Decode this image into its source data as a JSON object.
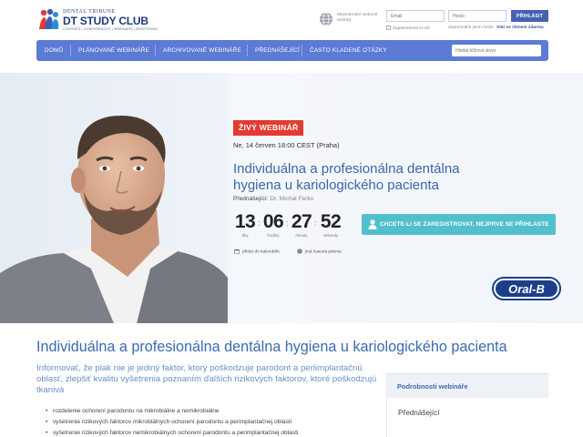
{
  "header": {
    "logo_small": "DENTAL TRIBUNE",
    "logo_main": "DT STUDY CLUB",
    "logo_tagline": "COURSES | CONFERENCES | WEBINARS | MENTORING",
    "lang_text": "Mezinárodní webové stránky"
  },
  "login": {
    "email_placeholder": "Email",
    "password_placeholder": "Heslo",
    "login_button": "PŘIHLÁSIT",
    "remember": "Zapamatovat si mě",
    "forgot": "Zapomněl/a jsem heslo",
    "new_account": "Stát se členem zdarma"
  },
  "nav": {
    "items": [
      {
        "label": "DOMŮ"
      },
      {
        "label": "PLÁNOVANÉ WEBINÁŘE"
      },
      {
        "label": "ARCHIVOVANÉ WEBINÁŘE"
      },
      {
        "label": "PŘEDNÁŠEJÍCÍ"
      },
      {
        "label": "ČASTO KLADENÉ OTÁZKY"
      }
    ],
    "search_placeholder": "Hledat klíčové slovo"
  },
  "hero": {
    "badge": "ŽIVÝ WEBINÁŘ",
    "date": "Ne, 14 červen 18:00 CEST (Praha)",
    "title": "Individuálna a profesionálna dentálna hygiena u kariologického pacienta",
    "speaker_label": "Přednášející:",
    "speaker_name": "Dr. Michal Ferko",
    "countdown": {
      "days": "13",
      "days_label": "dny",
      "hours": "06",
      "hours_label": "hodiny",
      "minutes": "27",
      "minutes_label": "minuty",
      "seconds": "52",
      "seconds_label": "sekundy"
    },
    "calendar": "přidat do kalendáře",
    "timezone": "jiná časová pásma",
    "register_button": "CHCETE-LI SE ZAREGISTROVAT, NEJPRVE SE PŘIHLASTE",
    "sponsor": "Oral-B"
  },
  "content": {
    "title": "Individuálna a profesionálna dentálna hygiena u kariologického pacienta",
    "intro": "Informovať, že plak nie je jediný faktor, ktorý poškodzuje parodont a perlimplantačnú oblasť, zlepšiť kvalitu vyšetrenia poznaním ďalších rizikových faktorov, ktoré poškodzujú tkanivá",
    "bullets": [
      "rozdelenie ochorení parodontu na mikrobiálne a nemikrobiálne",
      "vyšetrenie rizikových faktorov mikrobiálnych ochorení parodontu a perimplantačnej oblasti",
      "vyšetrenie rizikových faktorov nemikrobiálnych ochorení parodontu a perimplantačnej oblasti"
    ]
  },
  "side": {
    "heading": "Podrobnosti webináře",
    "item": "Přednášející"
  },
  "colors": {
    "nav": "#5b7bd5",
    "accent": "#3d6ab0",
    "live_badge": "#e33b31",
    "register": "#52bfcd"
  }
}
